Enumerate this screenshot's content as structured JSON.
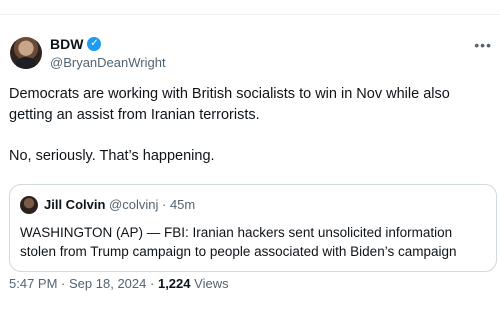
{
  "tweet": {
    "author": {
      "display_name": "BDW",
      "handle": "@BryanDeanWright",
      "verified": true,
      "verified_mark": "✓"
    },
    "more_icon": "•••",
    "text_lines": [
      "Democrats are working with British socialists to win in Nov while also getting an assist from Iranian terrorists.",
      "No, seriously. That’s happening."
    ],
    "quote": {
      "display_name": "Jill Colvin",
      "handle": "@colvinj",
      "separator": "·",
      "time": "45m",
      "text": "WASHINGTON (AP) — FBI: Iranian hackers sent unsolicited information stolen from Trump campaign to people associated with Biden’s campaign"
    },
    "meta": {
      "time": "5:47 PM",
      "separator1": "·",
      "date": "Sep 18, 2024",
      "separator2": "·",
      "views_count": "1,224",
      "views_label": "Views"
    }
  },
  "colors": {
    "text_primary": "#0f1419",
    "text_secondary": "#536471",
    "verified_blue": "#1d9bf0",
    "border": "#cfd9de"
  },
  "icons": {
    "verified": "verified-badge-icon",
    "more": "more-options-icon"
  }
}
